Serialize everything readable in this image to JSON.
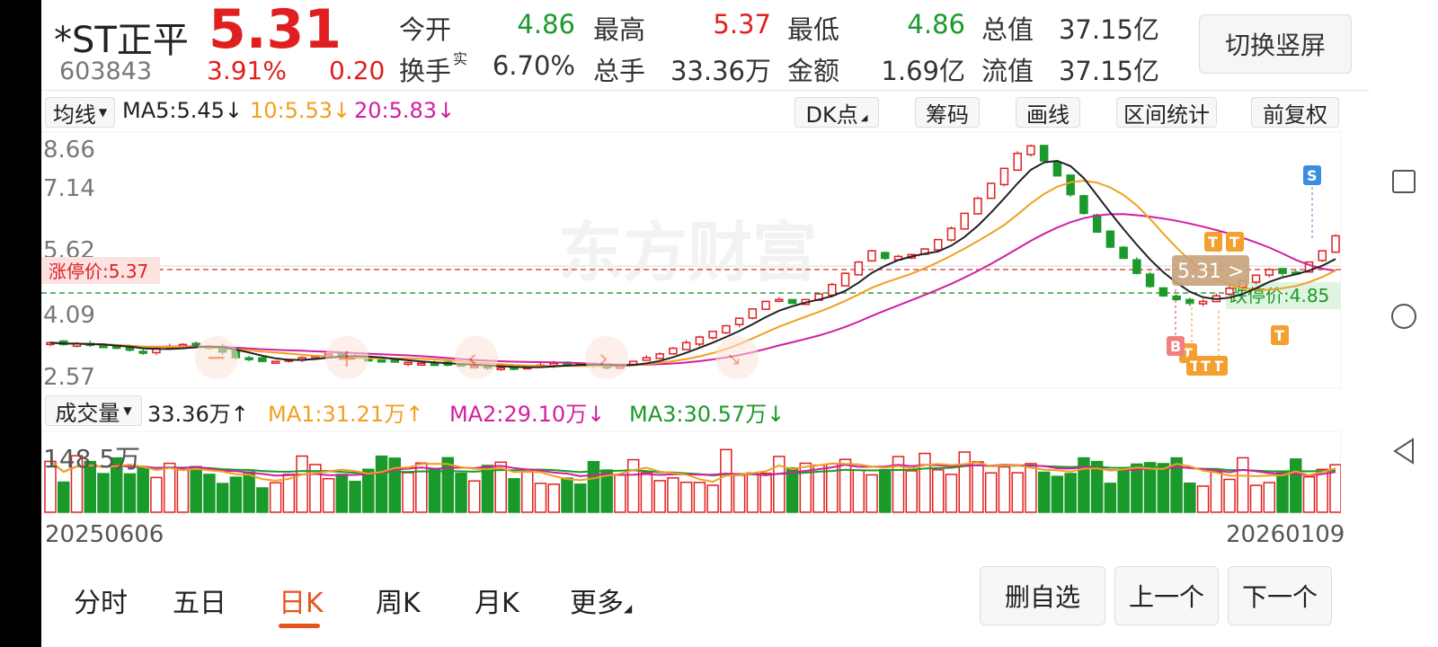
{
  "header": {
    "name": "*ST正平",
    "code": "603843",
    "price": "5.31",
    "change_pct": "3.91%",
    "change": "0.20",
    "switch_button": "切换竖屏"
  },
  "quote": {
    "open_label": "今开",
    "open": "4.86",
    "high_label": "最高",
    "high": "5.37",
    "low_label": "最低",
    "low": "4.86",
    "mktcap_label": "总值",
    "mktcap": "37.15亿",
    "turnover_label": "换手",
    "turnover_sup": "实",
    "turnover": "6.70%",
    "volume_label": "总手",
    "volume": "33.36万",
    "amount_label": "金额",
    "amount": "1.69亿",
    "float_label": "流值",
    "float": "37.15亿"
  },
  "toolbar": {
    "ma_select": "均线",
    "ma5": "MA5:5.45↓",
    "ma10": "10:5.53↓",
    "ma20": "20:5.83↓",
    "dk": "DK点",
    "chips": "筹码",
    "draw": "画线",
    "range_stats": "区间统计",
    "adjust": "前复权"
  },
  "price_chart": {
    "y_labels": [
      "8.66",
      "7.14",
      "5.62",
      "4.09",
      "2.57"
    ],
    "limit_up": "涨停价:5.37",
    "limit_down": "跌停价:4.85",
    "current_tag": "5.31 >",
    "watermark": "东方财富",
    "markers": [
      "T",
      "T",
      "T",
      "T",
      "T",
      "T",
      "T",
      "B",
      "S"
    ]
  },
  "volume": {
    "select": "成交量",
    "vol": "33.36万↑",
    "ma1": "MA1:31.21万↑",
    "ma2": "MA2:29.10万↓",
    "ma3": "MA3:30.57万↓",
    "y_label": "148.5万",
    "date_start": "20250606",
    "date_end": "20260109"
  },
  "tabs": [
    "分时",
    "五日",
    "日K",
    "周K",
    "月K",
    "更多"
  ],
  "active_tab": "日K",
  "bottom_buttons": {
    "delete": "删自选",
    "prev": "上一个",
    "next": "下一个"
  },
  "colors": {
    "up": "#e02020",
    "down": "#1a9a2a",
    "ma5": "#222222",
    "ma10": "#f0a020",
    "ma20": "#d020a0",
    "accent": "#e8541e"
  },
  "chart_data": {
    "type": "candlestick",
    "x_start": "20250606",
    "x_end": "20260109",
    "y_ticks": [
      8.66,
      7.14,
      5.62,
      4.09,
      2.57
    ],
    "limit_up": 5.37,
    "limit_down": 4.85,
    "last_close": 5.31,
    "close_series": [
      3.45,
      3.4,
      3.42,
      3.38,
      3.36,
      3.3,
      3.25,
      3.2,
      3.3,
      3.35,
      3.4,
      3.38,
      3.3,
      3.2,
      3.05,
      3.0,
      2.95,
      2.95,
      3.0,
      3.05,
      3.1,
      3.15,
      3.1,
      3.05,
      3.0,
      2.98,
      2.95,
      2.92,
      2.9,
      2.88,
      2.85,
      2.85,
      2.83,
      2.8,
      2.78,
      2.75,
      2.8,
      2.85,
      2.9,
      2.88,
      2.85,
      2.83,
      2.8,
      2.85,
      2.95,
      3.05,
      3.15,
      3.3,
      3.45,
      3.6,
      3.75,
      3.9,
      4.1,
      4.35,
      4.55,
      4.6,
      4.5,
      4.6,
      4.75,
      5.0,
      5.3,
      5.6,
      5.9,
      5.7,
      5.75,
      5.8,
      5.95,
      6.2,
      6.5,
      6.9,
      7.3,
      7.7,
      8.1,
      8.5,
      8.7,
      8.3,
      7.9,
      7.4,
      6.9,
      6.4,
      6.0,
      5.7,
      5.3,
      4.95,
      4.7,
      4.6,
      4.5,
      4.55,
      4.7,
      4.9,
      5.1,
      5.25,
      5.4,
      5.3,
      5.31,
      5.6,
      5.9,
      6.3
    ],
    "volume_ma": {
      "ma1": "31.21万",
      "ma2": "29.10万",
      "ma3": "30.57万"
    },
    "volume_max_label": "148.5万"
  }
}
